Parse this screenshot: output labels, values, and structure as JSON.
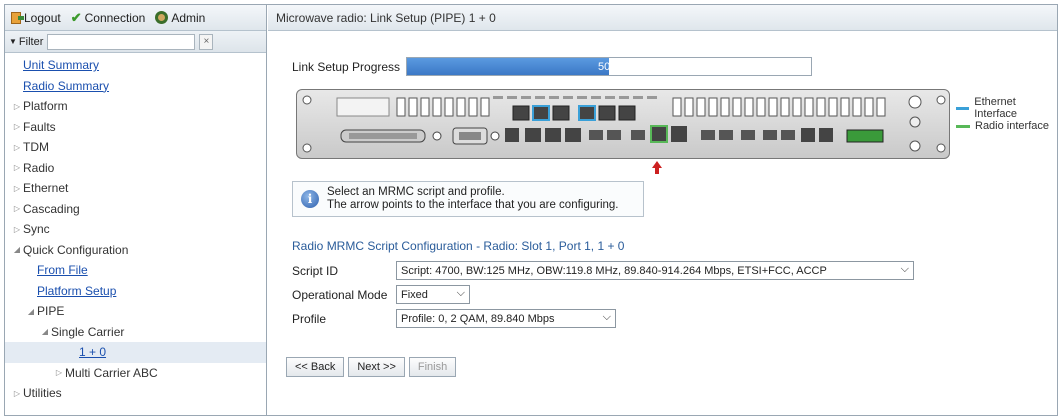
{
  "topbar": {
    "logout": "Logout",
    "connection": "Connection",
    "admin": "Admin"
  },
  "filter": {
    "label": "Filter",
    "value": "",
    "clear": "×"
  },
  "nav": [
    {
      "label": "Unit Summary",
      "link": true,
      "indent": 0,
      "arrow": ""
    },
    {
      "label": "Radio Summary",
      "link": true,
      "indent": 0,
      "arrow": ""
    },
    {
      "label": "Platform",
      "link": false,
      "indent": 0,
      "arrow": "▷"
    },
    {
      "label": "Faults",
      "link": false,
      "indent": 0,
      "arrow": "▷"
    },
    {
      "label": "TDM",
      "link": false,
      "indent": 0,
      "arrow": "▷"
    },
    {
      "label": "Radio",
      "link": false,
      "indent": 0,
      "arrow": "▷"
    },
    {
      "label": "Ethernet",
      "link": false,
      "indent": 0,
      "arrow": "▷"
    },
    {
      "label": "Cascading",
      "link": false,
      "indent": 0,
      "arrow": "▷"
    },
    {
      "label": "Sync",
      "link": false,
      "indent": 0,
      "arrow": "▷"
    },
    {
      "label": "Quick Configuration",
      "link": false,
      "indent": 0,
      "arrow": "◢"
    },
    {
      "label": "From File",
      "link": true,
      "indent": 1,
      "arrow": ""
    },
    {
      "label": "Platform Setup",
      "link": true,
      "indent": 1,
      "arrow": ""
    },
    {
      "label": "PIPE",
      "link": false,
      "indent": 1,
      "arrow": "◢"
    },
    {
      "label": "Single Carrier",
      "link": false,
      "indent": 2,
      "arrow": "◢"
    },
    {
      "label": "1 + 0",
      "link": true,
      "indent": 4,
      "arrow": "",
      "selected": true
    },
    {
      "label": "Multi Carrier ABC",
      "link": false,
      "indent": 3,
      "arrow": "▷"
    },
    {
      "label": "Utilities",
      "link": false,
      "indent": 0,
      "arrow": "▷"
    }
  ],
  "page": {
    "title": "Microwave radio: Link Setup (PIPE) 1 + 0",
    "progress_label": "Link Setup Progress",
    "progress_text": "50%",
    "progress_value": 50
  },
  "legend": {
    "ethernet": "Ethernet Interface",
    "radio": "Radio interface",
    "ethernet_color": "#3aa0d8",
    "radio_color": "#58b858"
  },
  "info": {
    "line1": "Select an MRMC script and profile.",
    "line2": "The arrow points to the interface that you are configuring."
  },
  "section": {
    "title": "Radio MRMC Script Configuration - Radio: Slot 1, Port 1, 1 + 0"
  },
  "form": {
    "script_id_label": "Script ID",
    "script_id_value": "Script: 4700, BW:125 MHz, OBW:119.8 MHz, 89.840-914.264 Mbps, ETSI+FCC, ACCP",
    "mode_label": "Operational Mode",
    "mode_value": "Fixed",
    "profile_label": "Profile",
    "profile_value": "Profile: 0, 2 QAM, 89.840 Mbps"
  },
  "buttons": {
    "back": "<< Back",
    "next": "Next >>",
    "finish": "Finish"
  }
}
